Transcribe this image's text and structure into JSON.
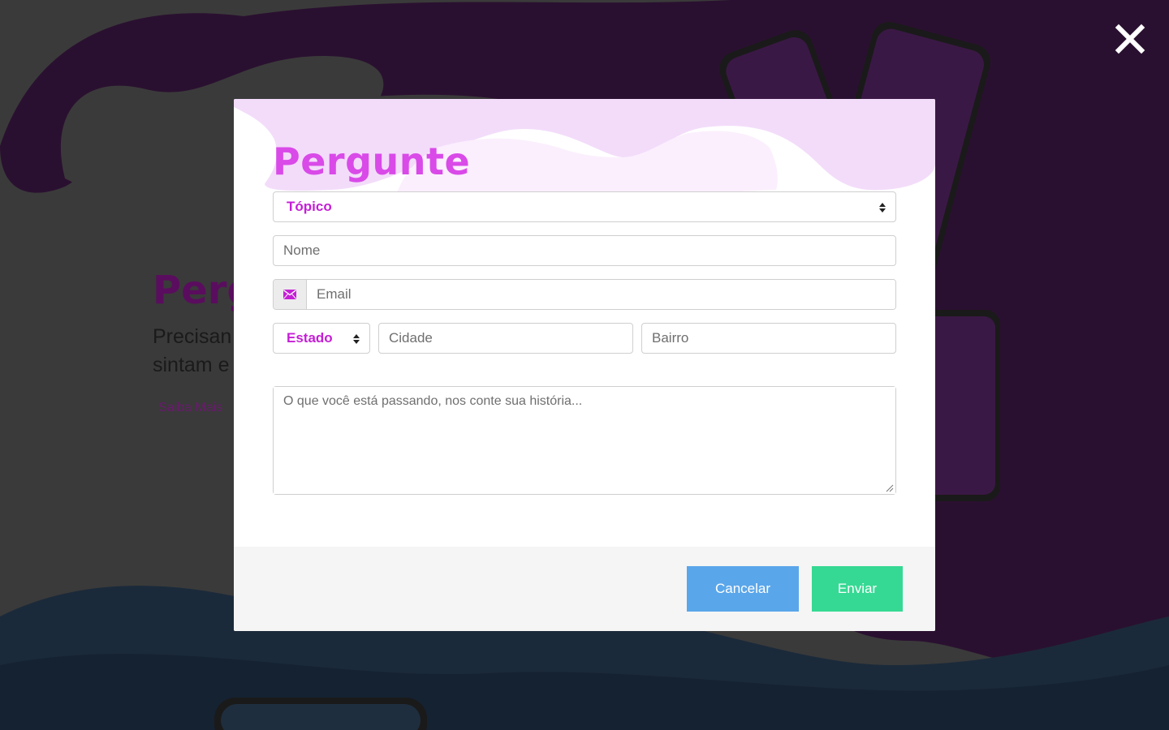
{
  "background": {
    "title": "Perg",
    "text_line1": "Precisan",
    "text_line2": "sintam e",
    "link": "Saiba Mais"
  },
  "close": {
    "icon": "close-icon"
  },
  "modal": {
    "title": "Pergunte",
    "topic_select": {
      "selected": "Tópico"
    },
    "name_input": {
      "placeholder": "Nome"
    },
    "email_input": {
      "placeholder": "Email",
      "icon": "envelope-icon"
    },
    "state_select": {
      "selected": "Estado"
    },
    "city_input": {
      "placeholder": "Cidade"
    },
    "district_input": {
      "placeholder": "Bairro"
    },
    "story_textarea": {
      "placeholder": "O que você está passando, nos conte sua história..."
    },
    "cancel_label": "Cancelar",
    "send_label": "Enviar"
  },
  "colors": {
    "accent": "#d94ae8",
    "select_text": "#c51fd6",
    "cancel": "#5aa6ea",
    "send": "#36d993"
  }
}
